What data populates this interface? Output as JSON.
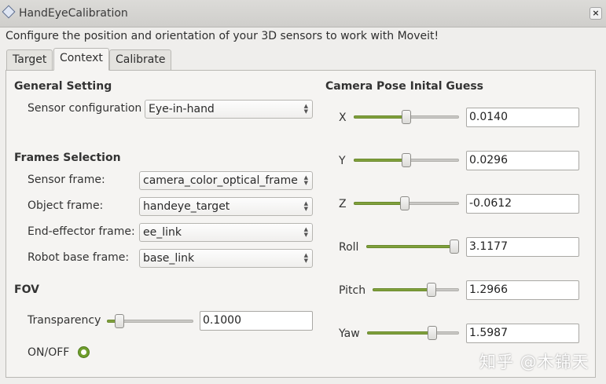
{
  "window": {
    "title": "HandEyeCalibration",
    "close_icon": "×"
  },
  "description": "Configure the position and orientation of your 3D sensors to work with Moveit!",
  "tabs": [
    {
      "label": "Target",
      "active": false
    },
    {
      "label": "Context",
      "active": true
    },
    {
      "label": "Calibrate",
      "active": false
    }
  ],
  "general": {
    "heading": "General Setting",
    "sensor_config_label": "Sensor configuration",
    "sensor_config_value": "Eye-in-hand"
  },
  "frames": {
    "heading": "Frames Selection",
    "sensor_label": "Sensor frame:",
    "sensor_value": "camera_color_optical_frame",
    "object_label": "Object frame:",
    "object_value": "handeye_target",
    "ee_label": "End-effector frame:",
    "ee_value": "ee_link",
    "base_label": "Robot base frame:",
    "base_value": "base_link"
  },
  "fov": {
    "heading": "FOV",
    "transparency_label": "Transparency",
    "transparency_value": "0.1000",
    "transparency_level": 0.1,
    "onoff_label": "ON/OFF",
    "onoff_checked": true
  },
  "pose": {
    "heading": "Camera Pose Inital Guess",
    "rows": [
      {
        "label": "X",
        "value": "0.0140",
        "level": 0.5
      },
      {
        "label": "Y",
        "value": "0.0296",
        "level": 0.5
      },
      {
        "label": "Z",
        "value": "-0.0612",
        "level": 0.48
      },
      {
        "label": "Roll",
        "value": "3.1177",
        "level": 1.0
      },
      {
        "label": "Pitch",
        "value": "1.2966",
        "level": 0.7
      },
      {
        "label": "Yaw",
        "value": "1.5987",
        "level": 0.73
      }
    ]
  },
  "watermark": "知乎 @木锦天",
  "colors": {
    "accent": "#80a03c",
    "background": "#efeeec",
    "panel": "#f5f4f2"
  }
}
